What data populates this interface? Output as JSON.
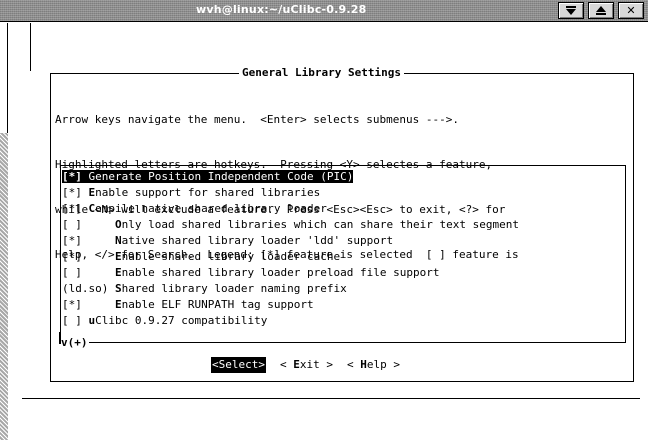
{
  "window": {
    "title": "wvh@linux:~/uClibc-0.9.28",
    "buttons": {
      "menu_icon": "menu-down-icon",
      "maximize_icon": "maximize-up-icon",
      "close_label": "✕"
    }
  },
  "dialog": {
    "title": "General Library Settings",
    "help_lines": [
      "Arrow keys navigate the menu.  <Enter> selects submenus --->.",
      "Highlighted letters are hotkeys.  Pressing <Y> selectes a feature,",
      "while <N> will exclude a feature.  Press <Esc><Esc> to exit, <?> for",
      "Help, </> for Search.  Legend: [*] feature is selected  [ ] feature is"
    ],
    "menu_items": [
      {
        "prefix": "[*]",
        "hotkey": "G",
        "rest": "enerate Position Independent Code (PIC)",
        "selected": true
      },
      {
        "prefix": "[*] ",
        "hotkey": "E",
        "rest": "nable support for shared libraries",
        "selected": false
      },
      {
        "prefix": "[*] ",
        "hotkey": "C",
        "rest": "ompile native shared library loader",
        "selected": false
      },
      {
        "prefix": "[ ]     ",
        "hotkey": "O",
        "rest": "nly load shared libraries which can share their text segment",
        "selected": false
      },
      {
        "prefix": "[*]     ",
        "hotkey": "N",
        "rest": "ative shared library loader 'ldd' support",
        "selected": false
      },
      {
        "prefix": "[*]     ",
        "hotkey": "E",
        "rest": "nable shared library loader cache",
        "selected": false
      },
      {
        "prefix": "[ ]     ",
        "hotkey": "E",
        "rest": "nable shared library loader preload file support",
        "selected": false
      },
      {
        "prefix": "(ld.so) ",
        "hotkey": "S",
        "rest": "hared library loader naming prefix",
        "selected": false
      },
      {
        "prefix": "[*]     ",
        "hotkey": "E",
        "rest": "nable ELF RUNPATH tag support",
        "selected": false
      },
      {
        "prefix": "[ ] ",
        "hotkey": "u",
        "rest": "Clibc 0.9.27 compatibility",
        "selected": false
      }
    ],
    "more_indicator": "v(+)",
    "buttons": {
      "select": "<Select>",
      "exit_pre": "< ",
      "exit_hot": "E",
      "exit_rest": "xit >",
      "help_pre": "< ",
      "help_hot": "H",
      "help_rest": "elp >"
    }
  }
}
